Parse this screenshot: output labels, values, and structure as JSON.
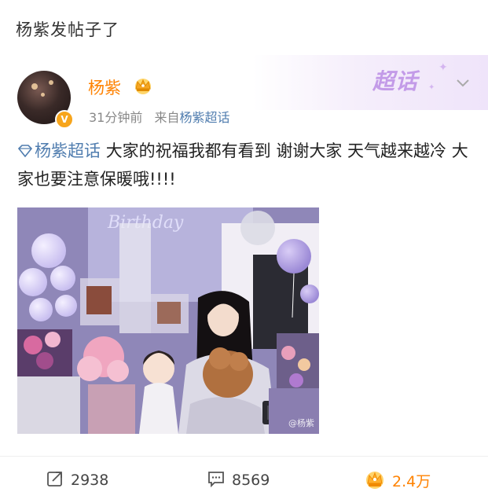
{
  "page": {
    "title": "杨紫发帖子了"
  },
  "post": {
    "author": "杨紫",
    "time": "31分钟前",
    "source_prefix": "来自",
    "source_name": "杨紫超话",
    "topic": "杨紫超话",
    "text": "大家的祝福我都有看到 谢谢大家 天气越来越冷 大家也要注意保暖哦!!!!",
    "banner_text": "超话",
    "image_watermark": "@杨紫"
  },
  "stats": {
    "reposts": "2938",
    "comments": "8569",
    "likes": "2.4万"
  },
  "colors": {
    "brand_orange": "#ff8200",
    "link_blue": "#507daf",
    "banner_purple": "#c39be8"
  },
  "icons": {
    "crown": "crown-icon",
    "verified": "verified-badge-icon",
    "topic": "super-topic-diamond-icon",
    "repost": "repost-icon",
    "comment": "comment-icon",
    "like": "like-thumb-icon",
    "menu": "chevron-down-icon"
  }
}
